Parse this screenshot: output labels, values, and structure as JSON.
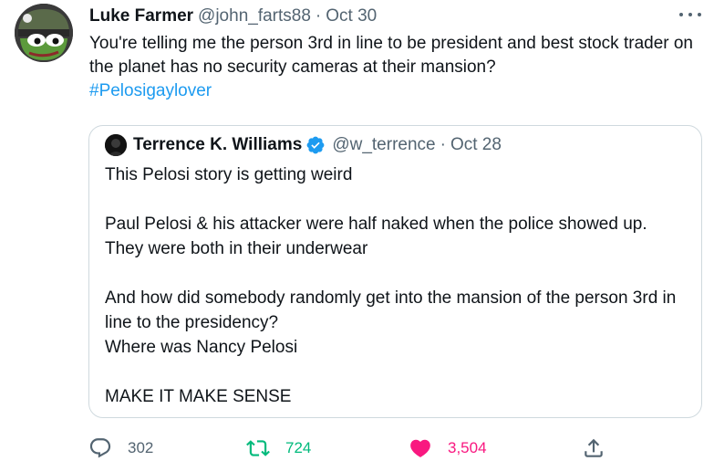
{
  "tweet": {
    "author": {
      "display_name": "Luke Farmer",
      "handle": "@john_farts88",
      "separator": "·",
      "date": "Oct 30",
      "avatar": "frog-avatar"
    },
    "text_line": "You're telling me the person 3rd in line to be president and best stock trader on the planet has no security cameras at their mansion?",
    "hashtag": "#Pelosigaylover",
    "more_icon": "more-dots-icon"
  },
  "quote": {
    "author": {
      "display_name": "Terrence K. Williams",
      "handle": "@w_terrence",
      "separator": "·",
      "date": "Oct 28",
      "verified": true,
      "verified_color": "#1d9bf0"
    },
    "paragraphs": [
      [
        "This Pelosi story is getting weird"
      ],
      [
        "Paul Pelosi & his attacker were half naked when the police showed up.",
        "They were both in their underwear"
      ],
      [
        "And how did somebody randomly get into the mansion of the person 3rd in line to the presidency?",
        "Where was Nancy Pelosi"
      ],
      [
        "MAKE IT MAKE SENSE"
      ]
    ]
  },
  "actions": {
    "reply": {
      "icon": "reply-icon",
      "count": "302"
    },
    "retweet": {
      "icon": "retweet-icon",
      "count": "724",
      "color": "#00ba7c"
    },
    "like": {
      "icon": "heart-icon",
      "count": "3,504",
      "color": "#f91880"
    },
    "share": {
      "icon": "share-icon"
    }
  }
}
